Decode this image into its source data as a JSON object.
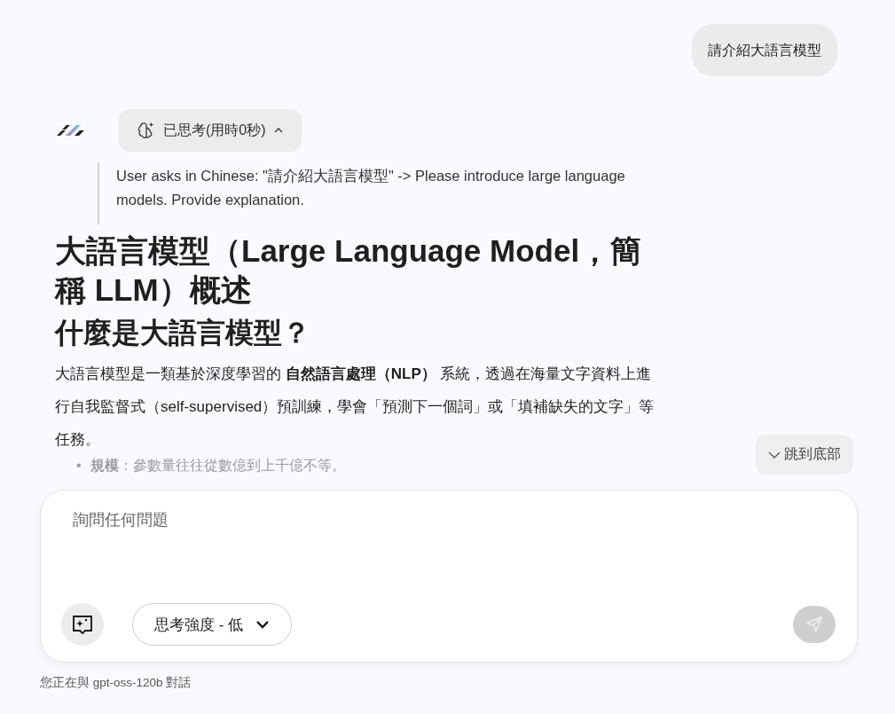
{
  "user_message": "請介紹大語言模型",
  "thinking": {
    "label": "已思考(用時0秒)",
    "expanded": true,
    "text": "User asks in Chinese: \"請介紹大語言模型\" -> Please introduce large language models. Provide explanation."
  },
  "answer": {
    "title": "大語言模型（Large Language Model，簡稱 LLM）概述",
    "subtitle": "什麼是大語言模型？",
    "paragraph": "大語言模型是一類基於深度學習的 **自然語言處理（NLP）** 系統，透過在海量文字資料上進行自我監督式（self-supervised）預訓練，學會「預測下一個詞」或「填補缺失的文字」等任務。",
    "bullets": [
      {
        "marker": "•",
        "text": "**規模**：參數量往往從數億到上千億不等。"
      }
    ]
  },
  "jump_button": "跳到底部",
  "composer": {
    "placeholder": "詢問任何問題",
    "effort": "思考強度 - 低",
    "send_disabled": true
  },
  "footer": "您正在與 gpt-oss-120b 對話"
}
